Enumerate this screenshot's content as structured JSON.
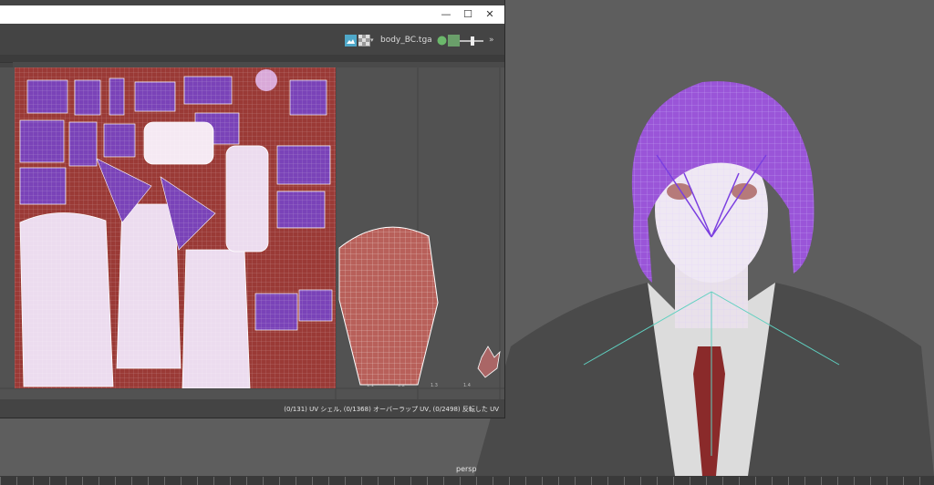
{
  "uv_editor": {
    "window_controls": {
      "minimize": "—",
      "maximize": "☐",
      "close": "✕"
    },
    "texture_name": "body_BC.tga",
    "status_message": "(0/131) UV シェル, (0/1368) オーバーラップ UV, (0/2498) 反転した UV",
    "ruler_labels": [
      "1.1",
      "1.2",
      "1.3",
      "1.4"
    ]
  },
  "viewport": {
    "camera_label": "persp"
  },
  "colors": {
    "viewport_bg": "#5e5e5e",
    "uv_canvas_bg": "#525252",
    "texture_base": "#9a3a36",
    "uv_wire": "#ffffff",
    "shell_purple": "#7a43b8",
    "hair": "#9a55d8"
  },
  "icons": [
    "image-icon",
    "checker-icon",
    "dropdown-icon",
    "shaded-icon",
    "exposure-icon",
    "chevron-right-icon"
  ]
}
